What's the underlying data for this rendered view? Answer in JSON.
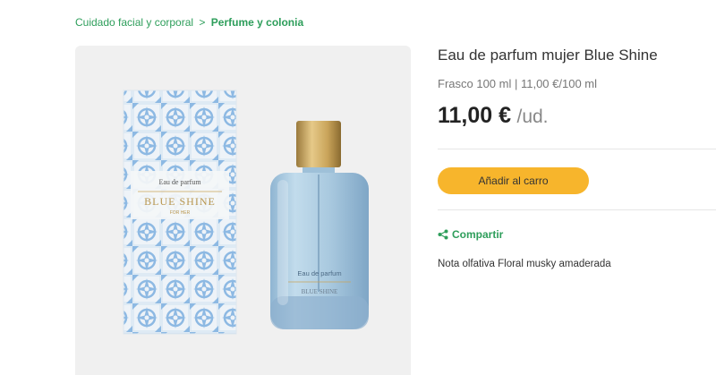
{
  "breadcrumb": {
    "parent": "Cuidado facial y corporal",
    "separator": ">",
    "current": "Perfume y colonia"
  },
  "product": {
    "title": "Eau de parfum mujer Blue Shine",
    "size_info": "Frasco 100 ml | 11,00 €/100 ml",
    "price": "11,00 €",
    "price_unit": "/ud.",
    "add_to_cart_label": "Añadir al carro",
    "share_label": "Compartir",
    "note": "Nota olfativa Floral musky amaderada"
  },
  "image": {
    "box_label_top": "Eau de parfum",
    "box_brand": "BLUE SHINE",
    "box_sub": "FOR HER",
    "bottle_label": "Eau de parfum",
    "bottle_sub": "BLUE SHINE"
  },
  "colors": {
    "accent_green": "#2e9e5b",
    "button_yellow": "#f7b52c",
    "panel_bg": "#f0f0f0",
    "tile_blue": "#8db9e3",
    "bottle_blue": "#a9c9df",
    "cap_gold": "#c9a45a"
  },
  "icons": {
    "share": "share-icon"
  }
}
